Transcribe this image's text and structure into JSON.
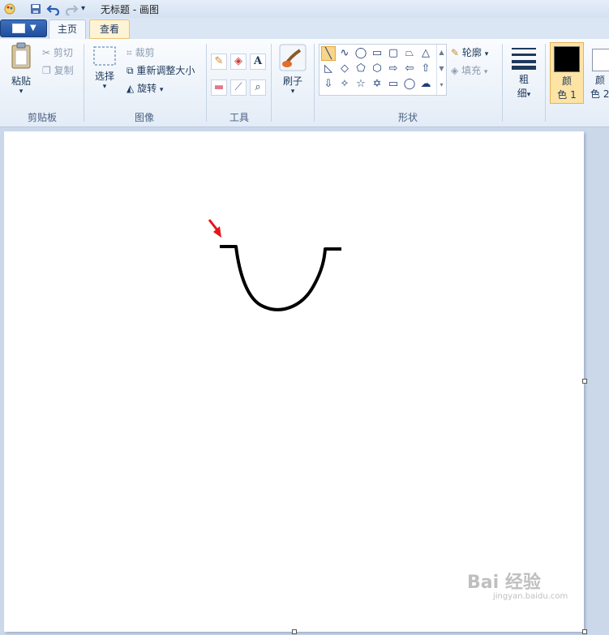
{
  "window": {
    "title": "无标题 - 画图"
  },
  "tabs": [
    {
      "label": "主页"
    },
    {
      "label": "查看"
    }
  ],
  "ribbon": {
    "clipboard": {
      "paste_label": "粘贴",
      "cut_label": "剪切",
      "copy_label": "复制",
      "group_label": "剪贴板"
    },
    "image": {
      "select_label": "选择",
      "crop_label": "裁剪",
      "resize_label": "重新调整大小",
      "rotate_label": "旋转",
      "group_label": "图像"
    },
    "tools": {
      "group_label": "工具"
    },
    "brushes": {
      "label": "刷子"
    },
    "shapes": {
      "outline_label": "轮廓",
      "fill_label": "填充",
      "group_label": "形状"
    },
    "size": {
      "label_line1": "粗",
      "label_line2": "细"
    },
    "colors": {
      "color1_line1": "颜",
      "color1_line2": "色 1",
      "color2_line1": "颜",
      "color2_line2": "色 2",
      "color1_value": "#000000",
      "color2_value": "#ffffff"
    }
  },
  "canvas": {
    "background": "#ffffff",
    "stroke_color": "#000000",
    "arrow_color": "#e3161b"
  },
  "watermark": {
    "text": "Bai 经验",
    "sub": "jingyan.baidu.com"
  }
}
